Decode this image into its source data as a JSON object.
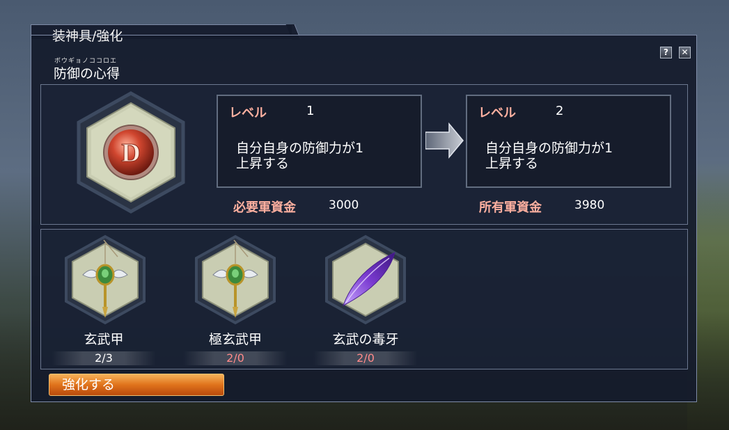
{
  "window": {
    "title": "装神具/強化",
    "furigana": "ボウギョノココロエ",
    "item_name": "防御の心得",
    "help_label": "?",
    "close_label": "✕"
  },
  "colors": {
    "accent": "#ffb0a0",
    "button": "#e0731c",
    "deficit": "#ff8a8a",
    "text": "#ffffff"
  },
  "icons": {
    "skill": "medallion-d-icon",
    "arrow": "right-arrow-icon"
  },
  "skill_emblem": "D",
  "current": {
    "label": "レベル",
    "level": "1",
    "description": "自分自身の防御力が1\n上昇する"
  },
  "next": {
    "label": "レベル",
    "level": "2",
    "description": "自分自身の防御力が1\n上昇する"
  },
  "cost": {
    "label": "必要軍資金",
    "value": "3000"
  },
  "owned": {
    "label": "所有軍資金",
    "value": "3980"
  },
  "materials": [
    {
      "name": "玄武甲",
      "count": "2/3",
      "icon": "amulet-icon",
      "sufficient": true
    },
    {
      "name": "極玄武甲",
      "count": "2/0",
      "icon": "amulet-icon",
      "sufficient": false
    },
    {
      "name": "玄武の毒牙",
      "count": "2/0",
      "icon": "purple-fang-icon",
      "sufficient": false
    }
  ],
  "actions": {
    "enhance_label": "強化する"
  }
}
